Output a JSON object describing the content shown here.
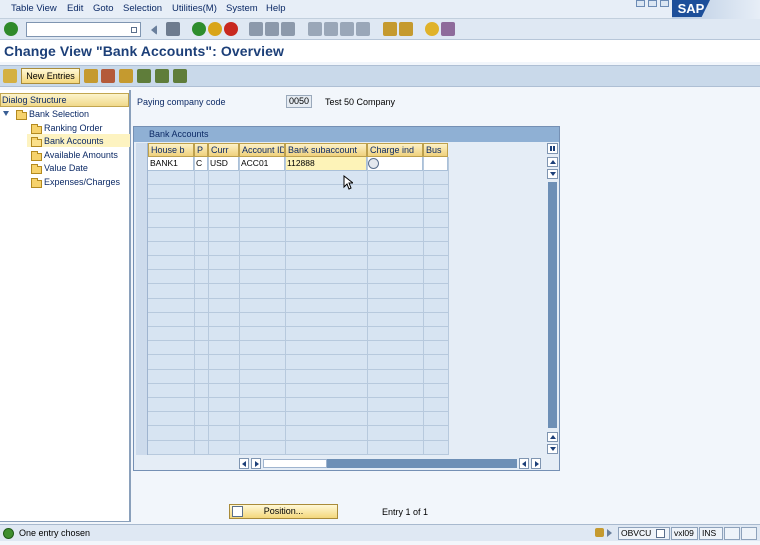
{
  "menu": {
    "items": [
      "Table View",
      "Edit",
      "Goto",
      "Selection",
      "Utilities(M)",
      "System",
      "Help"
    ],
    "logo": "SAP"
  },
  "title": "Change View \"Bank Accounts\": Overview",
  "app_toolbar": {
    "new_entries_label": "New Entries"
  },
  "dialog_structure": {
    "header": "Dialog Structure",
    "root": "Bank Selection",
    "items": [
      "Ranking Order",
      "Bank Accounts",
      "Available Amounts",
      "Value Date",
      "Expenses/Charges"
    ],
    "selected": "Bank Accounts"
  },
  "paying_company": {
    "label": "Paying company code",
    "value": "0050",
    "description": "Test 50 Company"
  },
  "table": {
    "title": "Bank Accounts",
    "columns": [
      "House b",
      "P",
      "Curr",
      "Account ID",
      "Bank subaccount",
      "Charge ind",
      "Bus"
    ],
    "rows": [
      [
        "BANK1",
        "C",
        "USD",
        "ACC01",
        "112888",
        "",
        ""
      ]
    ]
  },
  "position_button_label": "Position...",
  "entry_info": "Entry 1 of 1",
  "status": {
    "message": "One entry chosen",
    "system": "OBVCU",
    "client": "vxl09",
    "mode": "INS"
  },
  "colors": {
    "title": "#1c3f78",
    "header_yellow": "#f1d98b",
    "table_bg": "#d7e4f2",
    "status_ok": "#3e8e2e"
  }
}
